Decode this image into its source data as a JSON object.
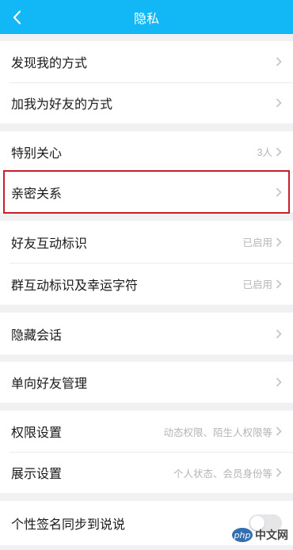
{
  "header": {
    "title": "隐私",
    "background": "#12b7f5"
  },
  "groups": [
    {
      "items": [
        {
          "label": "发现我的方式",
          "value": "",
          "chevron": true
        },
        {
          "label": "加我为好友的方式",
          "value": "",
          "chevron": true
        }
      ]
    },
    {
      "items": [
        {
          "label": "特别关心",
          "value": "3人",
          "chevron": true
        },
        {
          "label": "亲密关系",
          "value": "",
          "chevron": true,
          "highlighted": true
        }
      ]
    },
    {
      "items": [
        {
          "label": "好友互动标识",
          "value": "已启用",
          "chevron": true
        },
        {
          "label": "群互动标识及幸运字符",
          "value": "已启用",
          "chevron": true
        }
      ]
    },
    {
      "items": [
        {
          "label": "隐藏会话",
          "value": "",
          "chevron": true
        }
      ]
    },
    {
      "items": [
        {
          "label": "单向好友管理",
          "value": "",
          "chevron": true
        }
      ]
    },
    {
      "items": [
        {
          "label": "权限设置",
          "value": "动态权限、陌生人权限等",
          "chevron": true
        },
        {
          "label": "展示设置",
          "value": "个人状态、会员身份等",
          "chevron": true
        }
      ]
    },
    {
      "items": [
        {
          "label": "个性签名同步到说说",
          "toggle": "off"
        }
      ]
    }
  ],
  "highlight_color": "#c8202a",
  "watermark": {
    "logo": "php",
    "text": "中文网"
  }
}
